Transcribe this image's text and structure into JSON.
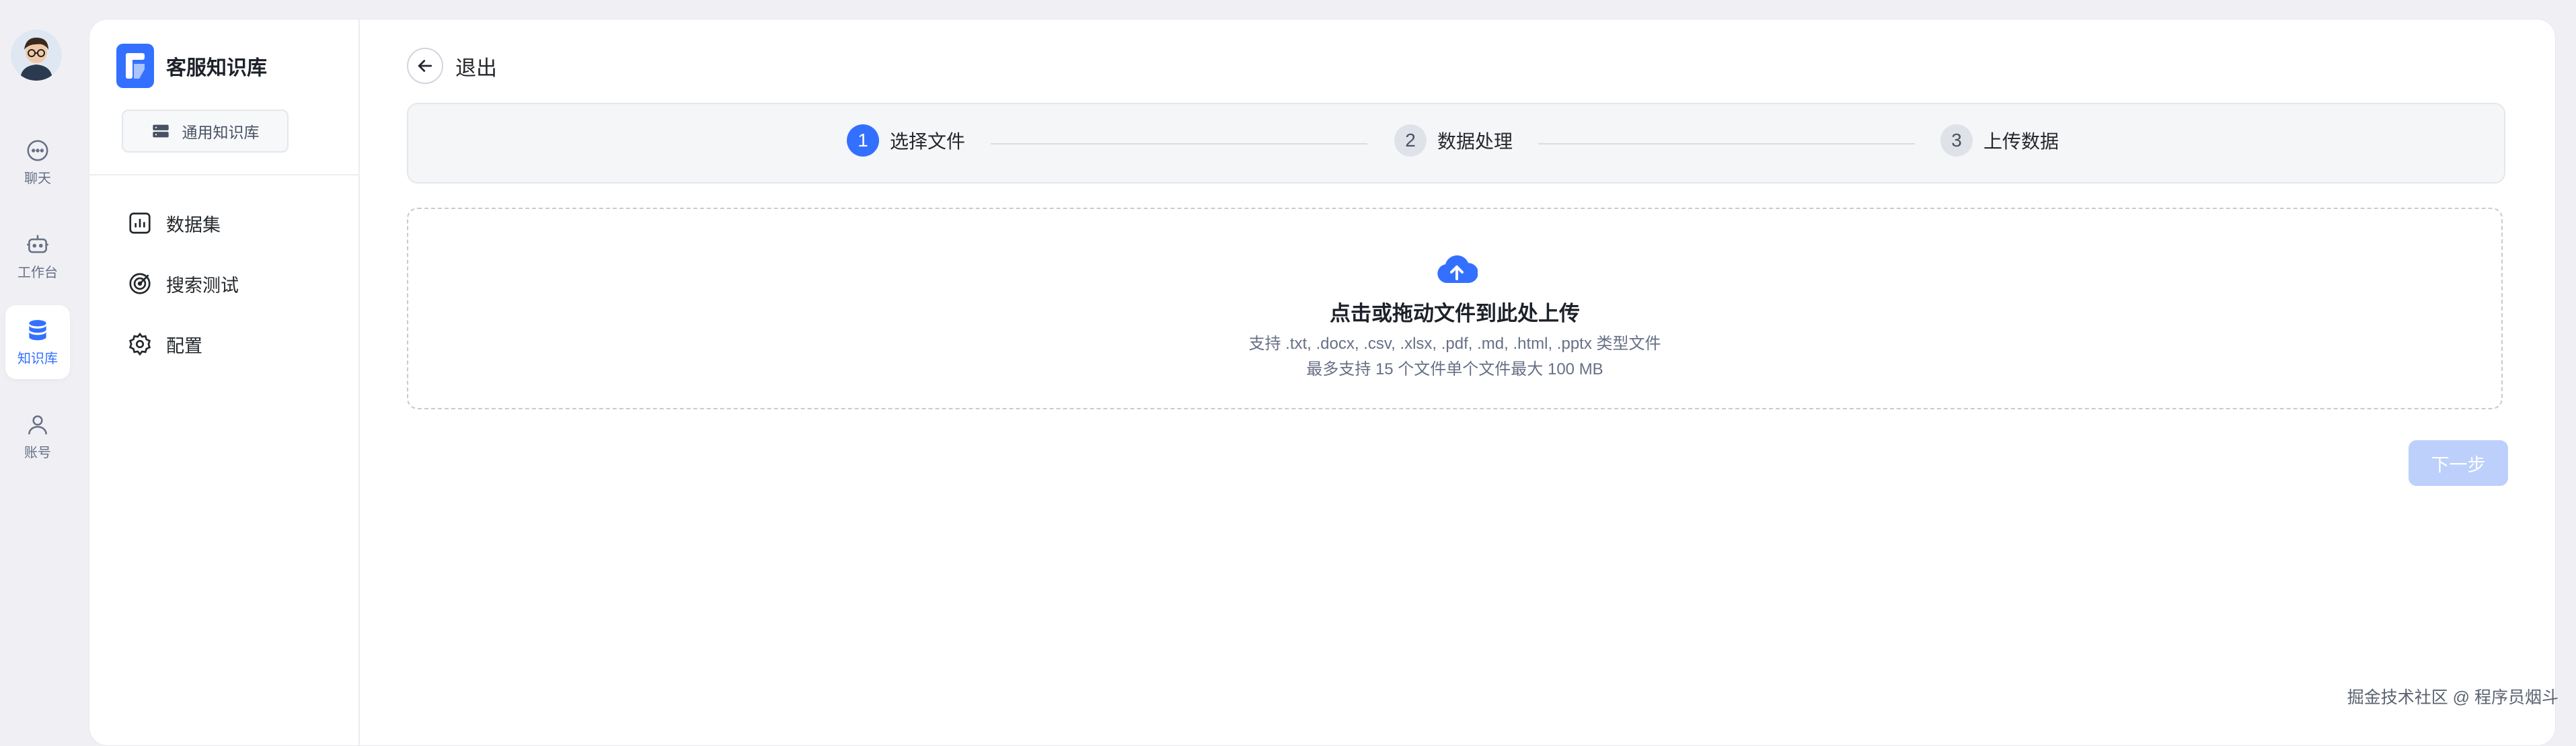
{
  "rail": {
    "items": [
      {
        "label": "聊天",
        "icon": "chat-icon"
      },
      {
        "label": "工作台",
        "icon": "robot-icon"
      },
      {
        "label": "知识库",
        "icon": "database-icon",
        "active": true
      },
      {
        "label": "账号",
        "icon": "user-icon"
      }
    ]
  },
  "sidebar": {
    "title": "客服知识库",
    "tag": "通用知识库",
    "items": [
      {
        "label": "数据集",
        "icon": "chart-icon"
      },
      {
        "label": "搜索测试",
        "icon": "target-icon"
      },
      {
        "label": "配置",
        "icon": "gear-icon"
      }
    ]
  },
  "header": {
    "exit_label": "退出"
  },
  "steps": [
    {
      "num": "1",
      "label": "选择文件",
      "active": true
    },
    {
      "num": "2",
      "label": "数据处理",
      "active": false
    },
    {
      "num": "3",
      "label": "上传数据",
      "active": false
    }
  ],
  "upload": {
    "title": "点击或拖动文件到此处上传",
    "formats": "支持 .txt, .docx, .csv, .xlsx, .pdf, .md, .html, .pptx 类型文件",
    "limit": "最多支持 15 个文件单个文件最大 100 MB"
  },
  "actions": {
    "next_label": "下一步"
  },
  "watermark": "掘金技术社区 @ 程序员烟斗",
  "colors": {
    "accent": "#3370ff",
    "next_disabled": "#bcd0fb"
  }
}
